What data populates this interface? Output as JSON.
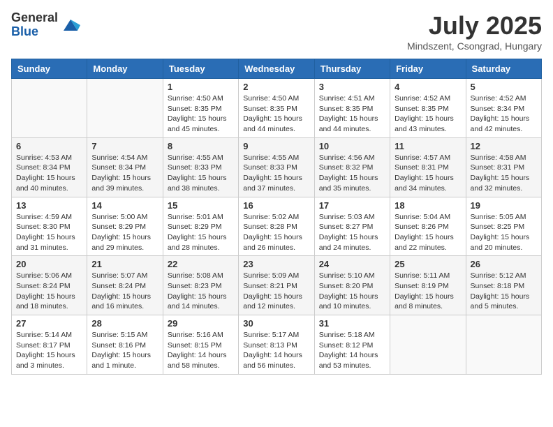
{
  "header": {
    "logo_general": "General",
    "logo_blue": "Blue",
    "month_title": "July 2025",
    "subtitle": "Mindszent, Csongrad, Hungary"
  },
  "calendar": {
    "days_of_week": [
      "Sunday",
      "Monday",
      "Tuesday",
      "Wednesday",
      "Thursday",
      "Friday",
      "Saturday"
    ],
    "weeks": [
      [
        {
          "day": "",
          "sunrise": "",
          "sunset": "",
          "daylight": ""
        },
        {
          "day": "",
          "sunrise": "",
          "sunset": "",
          "daylight": ""
        },
        {
          "day": "1",
          "sunrise": "Sunrise: 4:50 AM",
          "sunset": "Sunset: 8:35 PM",
          "daylight": "Daylight: 15 hours and 45 minutes."
        },
        {
          "day": "2",
          "sunrise": "Sunrise: 4:50 AM",
          "sunset": "Sunset: 8:35 PM",
          "daylight": "Daylight: 15 hours and 44 minutes."
        },
        {
          "day": "3",
          "sunrise": "Sunrise: 4:51 AM",
          "sunset": "Sunset: 8:35 PM",
          "daylight": "Daylight: 15 hours and 44 minutes."
        },
        {
          "day": "4",
          "sunrise": "Sunrise: 4:52 AM",
          "sunset": "Sunset: 8:35 PM",
          "daylight": "Daylight: 15 hours and 43 minutes."
        },
        {
          "day": "5",
          "sunrise": "Sunrise: 4:52 AM",
          "sunset": "Sunset: 8:34 PM",
          "daylight": "Daylight: 15 hours and 42 minutes."
        }
      ],
      [
        {
          "day": "6",
          "sunrise": "Sunrise: 4:53 AM",
          "sunset": "Sunset: 8:34 PM",
          "daylight": "Daylight: 15 hours and 40 minutes."
        },
        {
          "day": "7",
          "sunrise": "Sunrise: 4:54 AM",
          "sunset": "Sunset: 8:34 PM",
          "daylight": "Daylight: 15 hours and 39 minutes."
        },
        {
          "day": "8",
          "sunrise": "Sunrise: 4:55 AM",
          "sunset": "Sunset: 8:33 PM",
          "daylight": "Daylight: 15 hours and 38 minutes."
        },
        {
          "day": "9",
          "sunrise": "Sunrise: 4:55 AM",
          "sunset": "Sunset: 8:33 PM",
          "daylight": "Daylight: 15 hours and 37 minutes."
        },
        {
          "day": "10",
          "sunrise": "Sunrise: 4:56 AM",
          "sunset": "Sunset: 8:32 PM",
          "daylight": "Daylight: 15 hours and 35 minutes."
        },
        {
          "day": "11",
          "sunrise": "Sunrise: 4:57 AM",
          "sunset": "Sunset: 8:31 PM",
          "daylight": "Daylight: 15 hours and 34 minutes."
        },
        {
          "day": "12",
          "sunrise": "Sunrise: 4:58 AM",
          "sunset": "Sunset: 8:31 PM",
          "daylight": "Daylight: 15 hours and 32 minutes."
        }
      ],
      [
        {
          "day": "13",
          "sunrise": "Sunrise: 4:59 AM",
          "sunset": "Sunset: 8:30 PM",
          "daylight": "Daylight: 15 hours and 31 minutes."
        },
        {
          "day": "14",
          "sunrise": "Sunrise: 5:00 AM",
          "sunset": "Sunset: 8:29 PM",
          "daylight": "Daylight: 15 hours and 29 minutes."
        },
        {
          "day": "15",
          "sunrise": "Sunrise: 5:01 AM",
          "sunset": "Sunset: 8:29 PM",
          "daylight": "Daylight: 15 hours and 28 minutes."
        },
        {
          "day": "16",
          "sunrise": "Sunrise: 5:02 AM",
          "sunset": "Sunset: 8:28 PM",
          "daylight": "Daylight: 15 hours and 26 minutes."
        },
        {
          "day": "17",
          "sunrise": "Sunrise: 5:03 AM",
          "sunset": "Sunset: 8:27 PM",
          "daylight": "Daylight: 15 hours and 24 minutes."
        },
        {
          "day": "18",
          "sunrise": "Sunrise: 5:04 AM",
          "sunset": "Sunset: 8:26 PM",
          "daylight": "Daylight: 15 hours and 22 minutes."
        },
        {
          "day": "19",
          "sunrise": "Sunrise: 5:05 AM",
          "sunset": "Sunset: 8:25 PM",
          "daylight": "Daylight: 15 hours and 20 minutes."
        }
      ],
      [
        {
          "day": "20",
          "sunrise": "Sunrise: 5:06 AM",
          "sunset": "Sunset: 8:24 PM",
          "daylight": "Daylight: 15 hours and 18 minutes."
        },
        {
          "day": "21",
          "sunrise": "Sunrise: 5:07 AM",
          "sunset": "Sunset: 8:24 PM",
          "daylight": "Daylight: 15 hours and 16 minutes."
        },
        {
          "day": "22",
          "sunrise": "Sunrise: 5:08 AM",
          "sunset": "Sunset: 8:23 PM",
          "daylight": "Daylight: 15 hours and 14 minutes."
        },
        {
          "day": "23",
          "sunrise": "Sunrise: 5:09 AM",
          "sunset": "Sunset: 8:21 PM",
          "daylight": "Daylight: 15 hours and 12 minutes."
        },
        {
          "day": "24",
          "sunrise": "Sunrise: 5:10 AM",
          "sunset": "Sunset: 8:20 PM",
          "daylight": "Daylight: 15 hours and 10 minutes."
        },
        {
          "day": "25",
          "sunrise": "Sunrise: 5:11 AM",
          "sunset": "Sunset: 8:19 PM",
          "daylight": "Daylight: 15 hours and 8 minutes."
        },
        {
          "day": "26",
          "sunrise": "Sunrise: 5:12 AM",
          "sunset": "Sunset: 8:18 PM",
          "daylight": "Daylight: 15 hours and 5 minutes."
        }
      ],
      [
        {
          "day": "27",
          "sunrise": "Sunrise: 5:14 AM",
          "sunset": "Sunset: 8:17 PM",
          "daylight": "Daylight: 15 hours and 3 minutes."
        },
        {
          "day": "28",
          "sunrise": "Sunrise: 5:15 AM",
          "sunset": "Sunset: 8:16 PM",
          "daylight": "Daylight: 15 hours and 1 minute."
        },
        {
          "day": "29",
          "sunrise": "Sunrise: 5:16 AM",
          "sunset": "Sunset: 8:15 PM",
          "daylight": "Daylight: 14 hours and 58 minutes."
        },
        {
          "day": "30",
          "sunrise": "Sunrise: 5:17 AM",
          "sunset": "Sunset: 8:13 PM",
          "daylight": "Daylight: 14 hours and 56 minutes."
        },
        {
          "day": "31",
          "sunrise": "Sunrise: 5:18 AM",
          "sunset": "Sunset: 8:12 PM",
          "daylight": "Daylight: 14 hours and 53 minutes."
        },
        {
          "day": "",
          "sunrise": "",
          "sunset": "",
          "daylight": ""
        },
        {
          "day": "",
          "sunrise": "",
          "sunset": "",
          "daylight": ""
        }
      ]
    ]
  }
}
